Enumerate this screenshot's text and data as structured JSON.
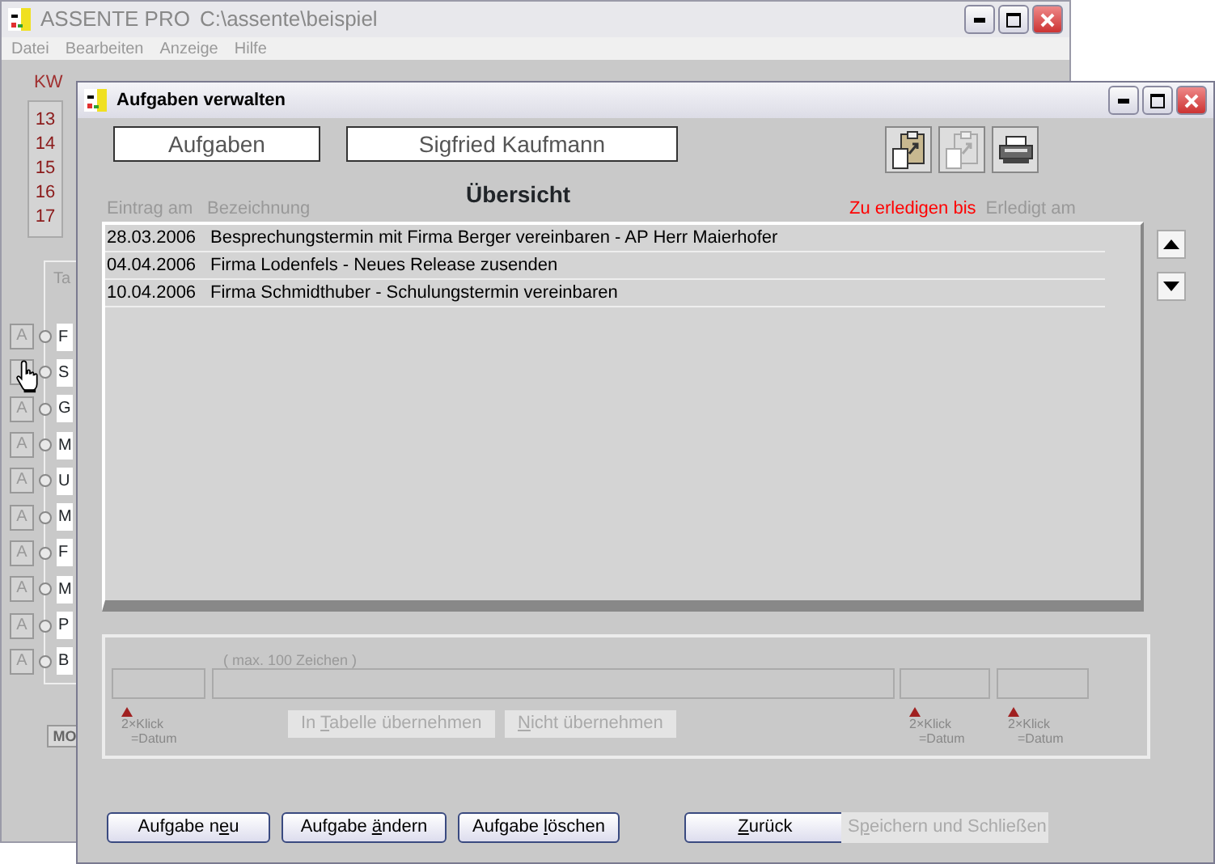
{
  "back_window": {
    "title": "ASSENTE PRO",
    "path": "C:\\assente\\beispiel",
    "menu": [
      "Datei",
      "Bearbeiten",
      "Anzeige",
      "Hilfe"
    ],
    "week_label": "KW",
    "weeks": [
      "13",
      "14",
      "15",
      "16",
      "17"
    ],
    "group_label": "Ta",
    "rows": [
      {
        "button": "A",
        "letter": "F",
        "selected": false
      },
      {
        "letter": "S",
        "selected": false
      },
      {
        "button": "A",
        "letter": "G",
        "selected": false
      },
      {
        "button": "A",
        "letter": "M",
        "selected": false
      },
      {
        "button": "A",
        "letter": "U",
        "selected": false
      },
      {
        "button": "A",
        "letter": "M",
        "selected": false
      },
      {
        "button": "A",
        "letter": "F",
        "selected": false
      },
      {
        "button": "A",
        "letter": "M",
        "selected": false
      },
      {
        "button": "A",
        "letter": "P",
        "selected": false
      },
      {
        "button": "A",
        "letter": "B",
        "selected": false
      }
    ],
    "bottom_button": "MO"
  },
  "window": {
    "title": "Aufgaben verwalten"
  },
  "header_fields": [
    "Aufgaben",
    "Sigfried Kaufmann"
  ],
  "toolbar": [
    {
      "kind": "paste",
      "disabled": false
    },
    {
      "kind": "paste",
      "disabled": true
    },
    {
      "kind": "print",
      "disabled": false
    }
  ],
  "overview_title": "Übersicht",
  "columns": [
    {
      "label": "Eintrag am",
      "highlight": false
    },
    {
      "label": "Bezeichnung",
      "highlight": false
    },
    {
      "label": "Zu erledigen bis",
      "highlight": true
    },
    {
      "label": "Erledigt am",
      "highlight": false
    }
  ],
  "tasks": [
    {
      "date": "28.03.2006",
      "text": "Besprechungstermin mit Firma Berger vereinbaren - AP Herr Maierhofer"
    },
    {
      "date": "04.04.2006",
      "text": "Firma Lodenfels - Neues Release zusenden"
    },
    {
      "date": "10.04.2006",
      "text": "Firma Schmidthuber - Schulungstermin vereinbaren"
    }
  ],
  "form": {
    "hint": "( max. 100 Zeichen )",
    "date_hints": [
      {
        "line1": "2×Klick",
        "line2": "=Datum"
      },
      {
        "line1": "2×Klick",
        "line2": "=Datum"
      },
      {
        "line1": "2×Klick",
        "line2": "=Datum"
      }
    ],
    "buttons": [
      {
        "pre": "In ",
        "key": "T",
        "post": "abelle übernehmen",
        "disabled": true
      },
      {
        "key": "N",
        "post": "icht übernehmen",
        "disabled": true
      }
    ]
  },
  "buttons": [
    {
      "pre": "Aufgabe n",
      "key": "e",
      "post": "u",
      "disabled": false
    },
    {
      "pre": "Aufgabe ",
      "key": "ä",
      "post": "ndern",
      "disabled": false
    },
    {
      "pre": "Aufgabe ",
      "key": "l",
      "post": "öschen",
      "disabled": false
    },
    {
      "key": "Z",
      "post": "urück",
      "disabled": false
    },
    {
      "pre": "S",
      "key": "p",
      "post": "eichern und Schließen",
      "disabled": true
    }
  ]
}
